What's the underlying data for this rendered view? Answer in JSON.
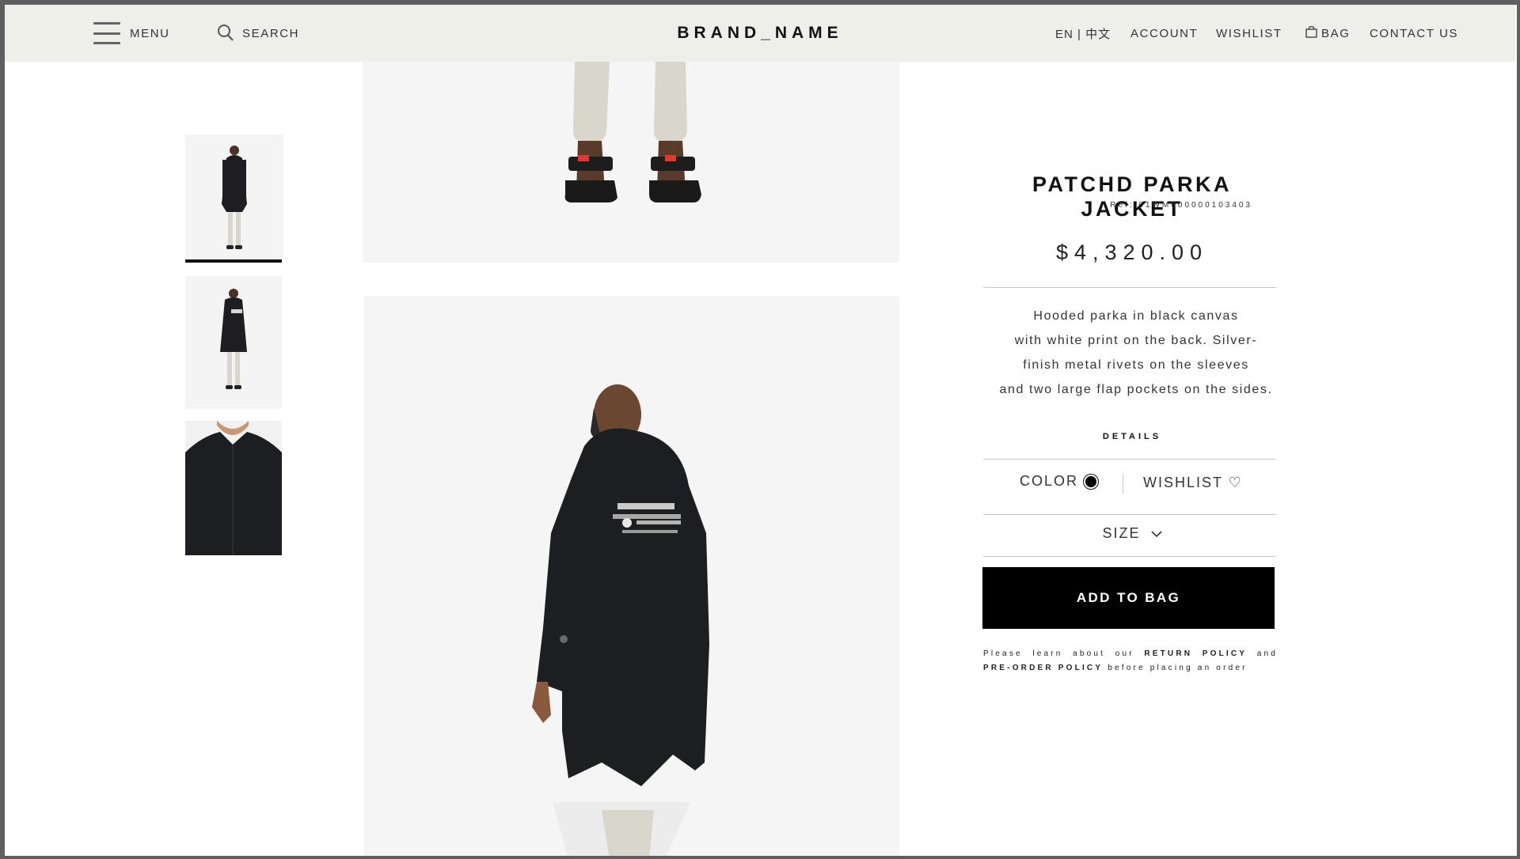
{
  "header": {
    "menu_label": "MENU",
    "search_label": "SEARCH",
    "brand": "BRAND_NAME",
    "language": "EN | 中文",
    "account": "ACCOUNT",
    "wishlist": "WISHLIST",
    "bag": "BAG",
    "contact": "CONTACT US"
  },
  "gallery": {
    "selected_index": 0,
    "thumbnails": [
      "front-view",
      "back-view",
      "close-up"
    ]
  },
  "product": {
    "title": "PATCHD PARKA JACKET",
    "ref": "Ref: 01WM000000103403",
    "price": "$4,320.00",
    "description": [
      "Hooded parka in black canvas",
      "with white print on the back. Silver-",
      "finish metal rivets on the sleeves",
      "and  two large flap pockets on the sides."
    ],
    "details_label": "DETAILS",
    "color_label": "COLOR",
    "color_value": "#000000",
    "wishlist_label": "WISHLIST ♡",
    "size_label": "SIZE",
    "add_to_bag": "ADD TO BAG",
    "policy": {
      "prefix": "Please learn about our",
      "return_policy": "RETURN POLICY",
      "and": "and",
      "preorder_policy": "PRE-ORDER POLICY",
      "suffix": "before placing an order"
    }
  },
  "colors": {
    "header_bg": "#efefea",
    "image_bg": "#f5f5f5",
    "button_bg": "#000000",
    "coat": "#1c1e22",
    "trousers": "#d9d6cc"
  }
}
